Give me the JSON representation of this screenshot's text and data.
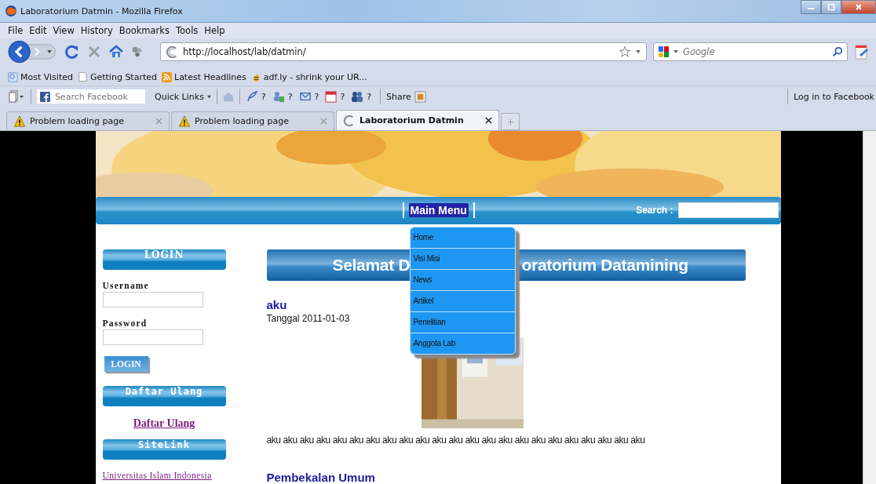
{
  "window": {
    "title": "Laboratorium Datmin - Mozilla Firefox"
  },
  "menu_bar": [
    "File",
    "Edit",
    "View",
    "History",
    "Bookmarks",
    "Tools",
    "Help"
  ],
  "address_bar": {
    "value": "http://localhost/lab/datmin/"
  },
  "search_field": {
    "placeholder": "Google"
  },
  "bookmarks": [
    "Most Visited",
    "Getting Started",
    "Latest Headlines",
    "adf.ly - shrink your UR..."
  ],
  "facebook_toolbar": {
    "search_placeholder": "Search Facebook",
    "quick_links": "Quick Links",
    "badges": [
      "?",
      "?",
      "?",
      "?",
      "?"
    ],
    "share": "Share",
    "login": "Log in to Facebook"
  },
  "tabs": [
    {
      "label": "Problem loading page",
      "kind": "error",
      "selected": false
    },
    {
      "label": "Problem loading page",
      "kind": "error",
      "selected": false
    },
    {
      "label": "Laboratorium Datmin",
      "kind": "page",
      "selected": true
    }
  ],
  "page": {
    "nav": {
      "main_menu": "Main Menu",
      "search_label": "Search :"
    },
    "dropdown": [
      "Home",
      "Visi Misi",
      "News",
      "Artikel",
      "Penelitian",
      "Anggota Lab"
    ],
    "sidebar": {
      "login_header": "LOGIN",
      "username_label": "Username",
      "password_label": "Password",
      "login_button": "LOGIN",
      "register_header": "Daftar Ulang",
      "register_link": "Daftar Ulang",
      "sitelink_header": "SiteLink",
      "sitelink": "Universitas Islam Indonesia"
    },
    "heading_parts": [
      "Selamat D",
      "oratorium Datamining"
    ],
    "post": {
      "title": "aku",
      "date": "Tanggal 2011-01-03",
      "body": "aku aku aku aku aku aku aku aku aku aku aku aku aku aku aku aku aku aku aku aku aku aku aku"
    },
    "next_title": "Pembekalan Umum"
  }
}
